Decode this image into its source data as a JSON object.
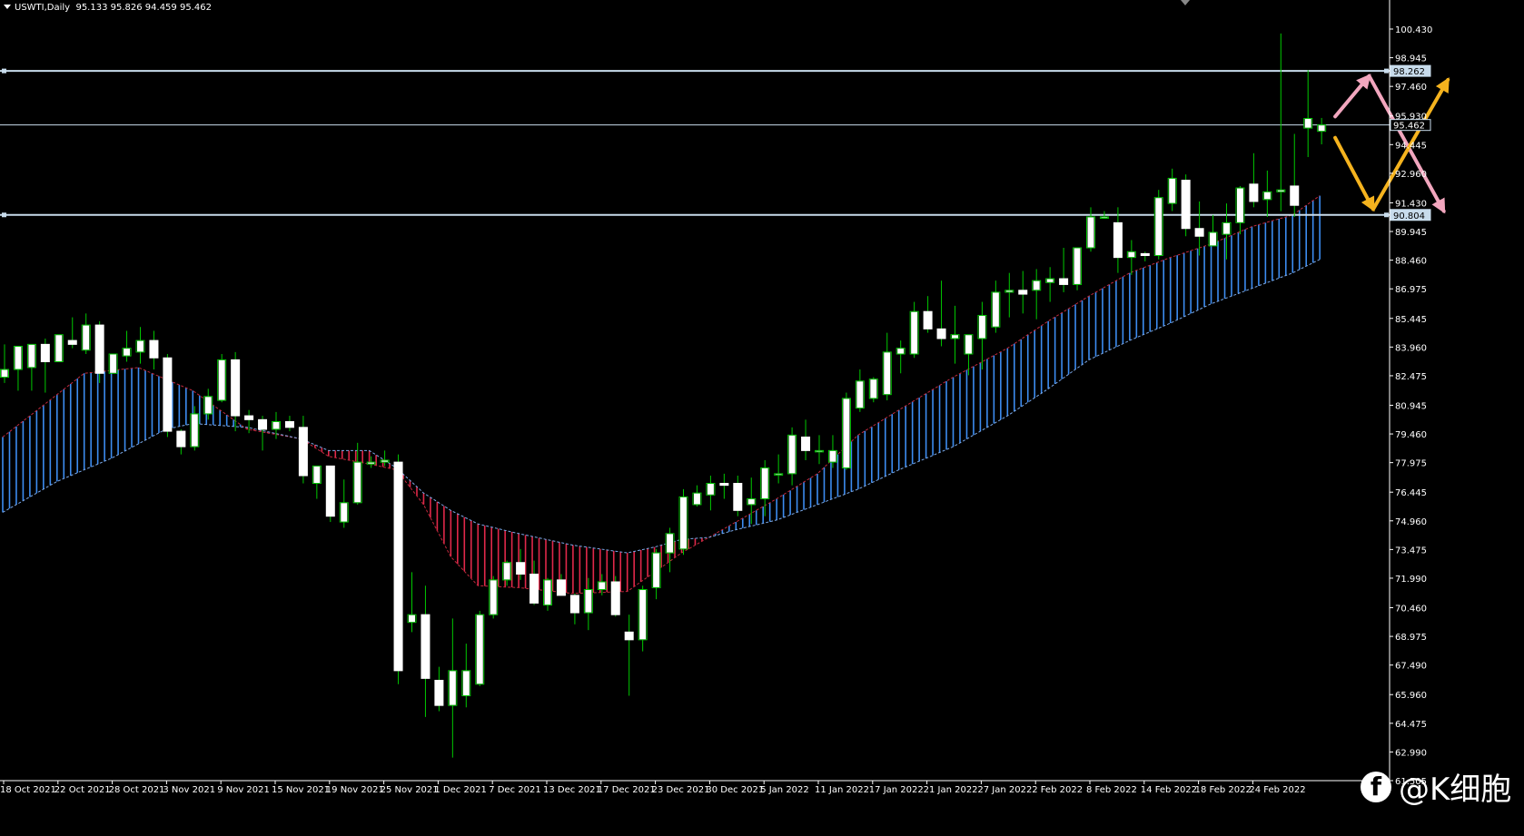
{
  "header": {
    "symbol": "USWTI,Daily",
    "ohlc": "95.133 95.826 94.459 95.462"
  },
  "watermark": {
    "icon": "facebook-icon",
    "text": "@K细胞"
  },
  "colors": {
    "background": "#000000",
    "up_candle_wick": "#00c800",
    "candle_body": "#ffffff",
    "kumo_bullish": "#3c8cf0",
    "kumo_bearish": "#e0284a",
    "level_line": "#c8dcec",
    "pink_arrow": "#f2a6be",
    "gold_arrow": "#f5b31e"
  },
  "chart_data": {
    "type": "candlestick",
    "symbol": "USWTI",
    "timeframe": "Daily",
    "ylim": [
      61.505,
      101.25
    ],
    "y_ticks": [
      "100.430",
      "98.945",
      "97.460",
      "95.930",
      "94.445",
      "92.960",
      "91.430",
      "89.945",
      "88.460",
      "86.975",
      "85.445",
      "83.960",
      "82.475",
      "80.945",
      "79.460",
      "77.975",
      "76.445",
      "74.960",
      "73.475",
      "71.990",
      "70.460",
      "68.975",
      "67.490",
      "65.960",
      "64.475",
      "62.990",
      "61.505"
    ],
    "y_tick_values": [
      100.43,
      98.945,
      97.46,
      95.93,
      94.445,
      92.96,
      91.43,
      89.945,
      88.46,
      86.975,
      85.445,
      83.96,
      82.475,
      80.945,
      79.46,
      77.975,
      76.445,
      74.96,
      73.475,
      71.99,
      70.46,
      68.975,
      67.49,
      65.96,
      64.475,
      62.99,
      61.505
    ],
    "x_tick_labels": [
      "18 Oct 2021",
      "22 Oct 2021",
      "28 Oct 2021",
      "3 Nov 2021",
      "9 Nov 2021",
      "15 Nov 2021",
      "19 Nov 2021",
      "25 Nov 2021",
      "1 Dec 2021",
      "7 Dec 2021",
      "13 Dec 2021",
      "17 Dec 2021",
      "23 Dec 2021",
      "30 Dec 2021",
      "5 Jan 2022",
      "11 Jan 2022",
      "17 Jan 2022",
      "21 Jan 2022",
      "27 Jan 2022",
      "2 Feb 2022",
      "8 Feb 2022",
      "14 Feb 2022",
      "18 Feb 2022",
      "24 Feb 2022"
    ],
    "x_tick_bar_index": [
      0,
      4,
      8,
      12,
      16,
      20,
      24,
      28,
      32,
      36,
      40,
      44,
      48,
      52,
      56,
      60,
      64,
      68,
      72,
      76,
      80,
      84,
      88,
      92
    ],
    "candles": [
      {
        "o": 82.4,
        "h": 84.1,
        "l": 82.1,
        "c": 82.8
      },
      {
        "o": 82.8,
        "h": 84.0,
        "l": 81.7,
        "c": 84.0
      },
      {
        "o": 82.9,
        "h": 84.1,
        "l": 81.7,
        "c": 84.1
      },
      {
        "o": 84.1,
        "h": 84.4,
        "l": 81.6,
        "c": 83.2
      },
      {
        "o": 83.2,
        "h": 84.5,
        "l": 83.2,
        "c": 84.6
      },
      {
        "o": 84.3,
        "h": 85.5,
        "l": 83.9,
        "c": 84.1
      },
      {
        "o": 83.8,
        "h": 85.7,
        "l": 83.6,
        "c": 85.1
      },
      {
        "o": 85.1,
        "h": 85.3,
        "l": 82.1,
        "c": 82.6
      },
      {
        "o": 82.6,
        "h": 83.5,
        "l": 82.6,
        "c": 83.6
      },
      {
        "o": 83.5,
        "h": 84.8,
        "l": 83.2,
        "c": 83.9
      },
      {
        "o": 83.7,
        "h": 85.0,
        "l": 83.1,
        "c": 84.3
      },
      {
        "o": 84.3,
        "h": 84.8,
        "l": 82.8,
        "c": 83.4
      },
      {
        "o": 83.4,
        "h": 83.6,
        "l": 79.3,
        "c": 79.6
      },
      {
        "o": 79.6,
        "h": 79.7,
        "l": 78.4,
        "c": 78.8
      },
      {
        "o": 78.8,
        "h": 80.9,
        "l": 78.6,
        "c": 80.5
      },
      {
        "o": 80.5,
        "h": 81.8,
        "l": 80.2,
        "c": 81.4
      },
      {
        "o": 81.2,
        "h": 83.6,
        "l": 81.1,
        "c": 83.3
      },
      {
        "o": 83.3,
        "h": 83.7,
        "l": 79.6,
        "c": 80.4
      },
      {
        "o": 80.4,
        "h": 80.7,
        "l": 79.5,
        "c": 80.2
      },
      {
        "o": 80.2,
        "h": 80.4,
        "l": 78.6,
        "c": 79.7
      },
      {
        "o": 79.7,
        "h": 80.6,
        "l": 79.2,
        "c": 80.1
      },
      {
        "o": 80.1,
        "h": 80.4,
        "l": 79.6,
        "c": 79.8
      },
      {
        "o": 79.8,
        "h": 80.4,
        "l": 76.9,
        "c": 77.3
      },
      {
        "o": 76.9,
        "h": 77.8,
        "l": 76.1,
        "c": 77.8
      },
      {
        "o": 77.8,
        "h": 77.8,
        "l": 74.9,
        "c": 75.2
      },
      {
        "o": 74.9,
        "h": 77.1,
        "l": 74.6,
        "c": 75.9
      },
      {
        "o": 75.9,
        "h": 79.0,
        "l": 75.8,
        "c": 78.0
      },
      {
        "o": 77.9,
        "h": 78.3,
        "l": 77.7,
        "c": 78.0
      },
      {
        "o": 78.0,
        "h": 78.6,
        "l": 77.8,
        "c": 78.1
      },
      {
        "o": 78.0,
        "h": 78.4,
        "l": 66.5,
        "c": 67.2
      },
      {
        "o": 69.7,
        "h": 72.3,
        "l": 69.2,
        "c": 70.1
      },
      {
        "o": 70.1,
        "h": 71.6,
        "l": 64.8,
        "c": 66.8
      },
      {
        "o": 66.7,
        "h": 67.4,
        "l": 65.1,
        "c": 65.4
      },
      {
        "o": 65.4,
        "h": 69.9,
        "l": 62.7,
        "c": 67.2
      },
      {
        "o": 65.9,
        "h": 68.6,
        "l": 65.3,
        "c": 67.2
      },
      {
        "o": 66.5,
        "h": 70.3,
        "l": 66.4,
        "c": 70.1
      },
      {
        "o": 70.1,
        "h": 72.1,
        "l": 69.9,
        "c": 71.9
      },
      {
        "o": 71.9,
        "h": 72.9,
        "l": 71.6,
        "c": 72.8
      },
      {
        "o": 72.8,
        "h": 73.5,
        "l": 71.9,
        "c": 72.2
      },
      {
        "o": 72.2,
        "h": 72.9,
        "l": 70.6,
        "c": 70.7
      },
      {
        "o": 70.6,
        "h": 72.0,
        "l": 70.3,
        "c": 71.9
      },
      {
        "o": 71.9,
        "h": 72.2,
        "l": 71.1,
        "c": 71.1
      },
      {
        "o": 71.1,
        "h": 71.2,
        "l": 69.6,
        "c": 70.2
      },
      {
        "o": 70.2,
        "h": 72.0,
        "l": 69.3,
        "c": 71.4
      },
      {
        "o": 71.4,
        "h": 72.2,
        "l": 71.1,
        "c": 71.8
      },
      {
        "o": 71.8,
        "h": 72.1,
        "l": 70.0,
        "c": 70.1
      },
      {
        "o": 69.2,
        "h": 70.1,
        "l": 65.9,
        "c": 68.8
      },
      {
        "o": 68.8,
        "h": 71.6,
        "l": 68.2,
        "c": 71.4
      },
      {
        "o": 71.5,
        "h": 73.5,
        "l": 70.9,
        "c": 73.3
      },
      {
        "o": 73.3,
        "h": 74.6,
        "l": 72.3,
        "c": 74.3
      },
      {
        "o": 73.5,
        "h": 76.6,
        "l": 73.2,
        "c": 76.2
      },
      {
        "o": 75.8,
        "h": 76.8,
        "l": 75.7,
        "c": 76.4
      },
      {
        "o": 76.3,
        "h": 77.3,
        "l": 75.5,
        "c": 76.9
      },
      {
        "o": 76.9,
        "h": 77.4,
        "l": 76.1,
        "c": 76.8
      },
      {
        "o": 76.9,
        "h": 77.3,
        "l": 75.2,
        "c": 75.5
      },
      {
        "o": 75.8,
        "h": 77.2,
        "l": 74.8,
        "c": 76.1
      },
      {
        "o": 76.1,
        "h": 78.1,
        "l": 75.2,
        "c": 77.7
      },
      {
        "o": 77.4,
        "h": 78.4,
        "l": 76.9,
        "c": 77.4
      },
      {
        "o": 77.4,
        "h": 79.8,
        "l": 76.8,
        "c": 79.4
      },
      {
        "o": 79.3,
        "h": 80.2,
        "l": 78.1,
        "c": 78.6
      },
      {
        "o": 78.6,
        "h": 79.4,
        "l": 77.9,
        "c": 78.6
      },
      {
        "o": 78.0,
        "h": 79.4,
        "l": 77.7,
        "c": 78.6
      },
      {
        "o": 77.7,
        "h": 81.6,
        "l": 77.6,
        "c": 81.3
      },
      {
        "o": 80.8,
        "h": 82.8,
        "l": 80.6,
        "c": 82.2
      },
      {
        "o": 81.3,
        "h": 82.4,
        "l": 81.1,
        "c": 82.3
      },
      {
        "o": 81.5,
        "h": 84.7,
        "l": 81.2,
        "c": 83.7
      },
      {
        "o": 83.6,
        "h": 84.3,
        "l": 82.6,
        "c": 83.9
      },
      {
        "o": 83.6,
        "h": 86.3,
        "l": 83.4,
        "c": 85.8
      },
      {
        "o": 85.8,
        "h": 86.6,
        "l": 84.7,
        "c": 84.9
      },
      {
        "o": 84.9,
        "h": 87.4,
        "l": 84.0,
        "c": 84.4
      },
      {
        "o": 84.4,
        "h": 86.1,
        "l": 83.1,
        "c": 84.6
      },
      {
        "o": 83.6,
        "h": 84.6,
        "l": 82.5,
        "c": 84.6
      },
      {
        "o": 84.4,
        "h": 86.3,
        "l": 82.8,
        "c": 85.6
      },
      {
        "o": 85.0,
        "h": 87.4,
        "l": 84.7,
        "c": 86.8
      },
      {
        "o": 86.8,
        "h": 87.8,
        "l": 85.5,
        "c": 86.9
      },
      {
        "o": 86.9,
        "h": 87.9,
        "l": 85.7,
        "c": 86.7
      },
      {
        "o": 86.9,
        "h": 88.0,
        "l": 85.4,
        "c": 87.4
      },
      {
        "o": 87.3,
        "h": 88.1,
        "l": 86.3,
        "c": 87.5
      },
      {
        "o": 87.5,
        "h": 89.1,
        "l": 86.8,
        "c": 87.2
      },
      {
        "o": 87.2,
        "h": 88.8,
        "l": 86.9,
        "c": 89.1
      },
      {
        "o": 89.1,
        "h": 91.2,
        "l": 88.9,
        "c": 90.7
      },
      {
        "o": 90.7,
        "h": 91.0,
        "l": 90.6,
        "c": 90.7
      },
      {
        "o": 90.4,
        "h": 91.2,
        "l": 87.8,
        "c": 88.6
      },
      {
        "o": 88.6,
        "h": 89.5,
        "l": 87.7,
        "c": 88.9
      },
      {
        "o": 88.8,
        "h": 88.9,
        "l": 88.4,
        "c": 88.7
      },
      {
        "o": 88.7,
        "h": 92.1,
        "l": 88.5,
        "c": 91.7
      },
      {
        "o": 91.4,
        "h": 93.2,
        "l": 91.0,
        "c": 92.7
      },
      {
        "o": 92.6,
        "h": 92.9,
        "l": 89.7,
        "c": 90.1
      },
      {
        "o": 90.1,
        "h": 91.5,
        "l": 88.7,
        "c": 89.7
      },
      {
        "o": 89.2,
        "h": 90.8,
        "l": 89.2,
        "c": 89.9
      },
      {
        "o": 89.8,
        "h": 91.4,
        "l": 88.5,
        "c": 90.4
      },
      {
        "o": 90.4,
        "h": 92.3,
        "l": 89.8,
        "c": 92.2
      },
      {
        "o": 92.4,
        "h": 94.0,
        "l": 91.2,
        "c": 91.5
      },
      {
        "o": 91.6,
        "h": 93.1,
        "l": 90.7,
        "c": 92.0
      },
      {
        "o": 92.0,
        "h": 100.2,
        "l": 91.0,
        "c": 92.1
      },
      {
        "o": 92.3,
        "h": 95.0,
        "l": 90.7,
        "c": 91.3
      },
      {
        "o": 95.3,
        "h": 98.3,
        "l": 93.8,
        "c": 95.8
      },
      {
        "o": 95.133,
        "h": 95.826,
        "l": 94.459,
        "c": 95.462
      }
    ],
    "kumo_span_a": [
      [
        0,
        79.3
      ],
      [
        6,
        82.6
      ],
      [
        10,
        82.9
      ],
      [
        14,
        81.7
      ],
      [
        18,
        79.7
      ],
      [
        22,
        79.2
      ],
      [
        24,
        78.3
      ],
      [
        27,
        77.9
      ],
      [
        29,
        77.6
      ],
      [
        31,
        75.8
      ],
      [
        33,
        73.1
      ],
      [
        35,
        71.6
      ],
      [
        38,
        71.5
      ],
      [
        42,
        71.2
      ],
      [
        46,
        71.3
      ],
      [
        48,
        72.3
      ],
      [
        50,
        73.3
      ],
      [
        52,
        74.1
      ],
      [
        54,
        74.9
      ],
      [
        57,
        76.1
      ],
      [
        60,
        77.4
      ],
      [
        63,
        79.4
      ],
      [
        66,
        80.7
      ],
      [
        70,
        82.4
      ],
      [
        74,
        83.9
      ],
      [
        77,
        85.3
      ],
      [
        80,
        86.6
      ],
      [
        83,
        87.8
      ],
      [
        86,
        88.6
      ],
      [
        89,
        89.3
      ],
      [
        92,
        90.2
      ],
      [
        95,
        90.8
      ],
      [
        97,
        91.8
      ]
    ],
    "kumo_span_b": [
      [
        0,
        75.4
      ],
      [
        4,
        77.0
      ],
      [
        8,
        78.2
      ],
      [
        12,
        79.7
      ],
      [
        14,
        80.0
      ],
      [
        18,
        79.8
      ],
      [
        22,
        79.2
      ],
      [
        24,
        78.6
      ],
      [
        27,
        78.6
      ],
      [
        29,
        77.7
      ],
      [
        31,
        76.4
      ],
      [
        33,
        75.5
      ],
      [
        35,
        74.8
      ],
      [
        38,
        74.3
      ],
      [
        42,
        73.7
      ],
      [
        46,
        73.3
      ],
      [
        48,
        73.6
      ],
      [
        50,
        74.0
      ],
      [
        52,
        74.1
      ],
      [
        54,
        74.5
      ],
      [
        57,
        75.0
      ],
      [
        60,
        75.8
      ],
      [
        63,
        76.6
      ],
      [
        66,
        77.6
      ],
      [
        70,
        78.8
      ],
      [
        74,
        80.4
      ],
      [
        77,
        81.8
      ],
      [
        80,
        83.3
      ],
      [
        83,
        84.3
      ],
      [
        86,
        85.2
      ],
      [
        89,
        86.2
      ],
      [
        92,
        87.0
      ],
      [
        95,
        87.8
      ],
      [
        97,
        88.5
      ]
    ],
    "horizontal_levels": [
      {
        "value": 98.262,
        "label": "98.262",
        "style": "thick"
      },
      {
        "value": 95.462,
        "label": "95.462",
        "style": "thin"
      },
      {
        "value": 90.804,
        "label": "90.804",
        "style": "thick"
      }
    ],
    "annotations": [
      {
        "type": "arrow",
        "color": "pink",
        "from": [
          98,
          95.9
        ],
        "to": [
          100.5,
          98.0
        ]
      },
      {
        "type": "arrow",
        "color": "pink",
        "from": [
          100.5,
          98.0
        ],
        "to": [
          106,
          91.0
        ]
      },
      {
        "type": "arrow",
        "color": "gold",
        "from": [
          98,
          94.8
        ],
        "to": [
          100.8,
          91.1
        ]
      },
      {
        "type": "arrow",
        "color": "gold",
        "from": [
          100.8,
          91.1
        ],
        "to": [
          106.3,
          97.8
        ]
      }
    ]
  }
}
